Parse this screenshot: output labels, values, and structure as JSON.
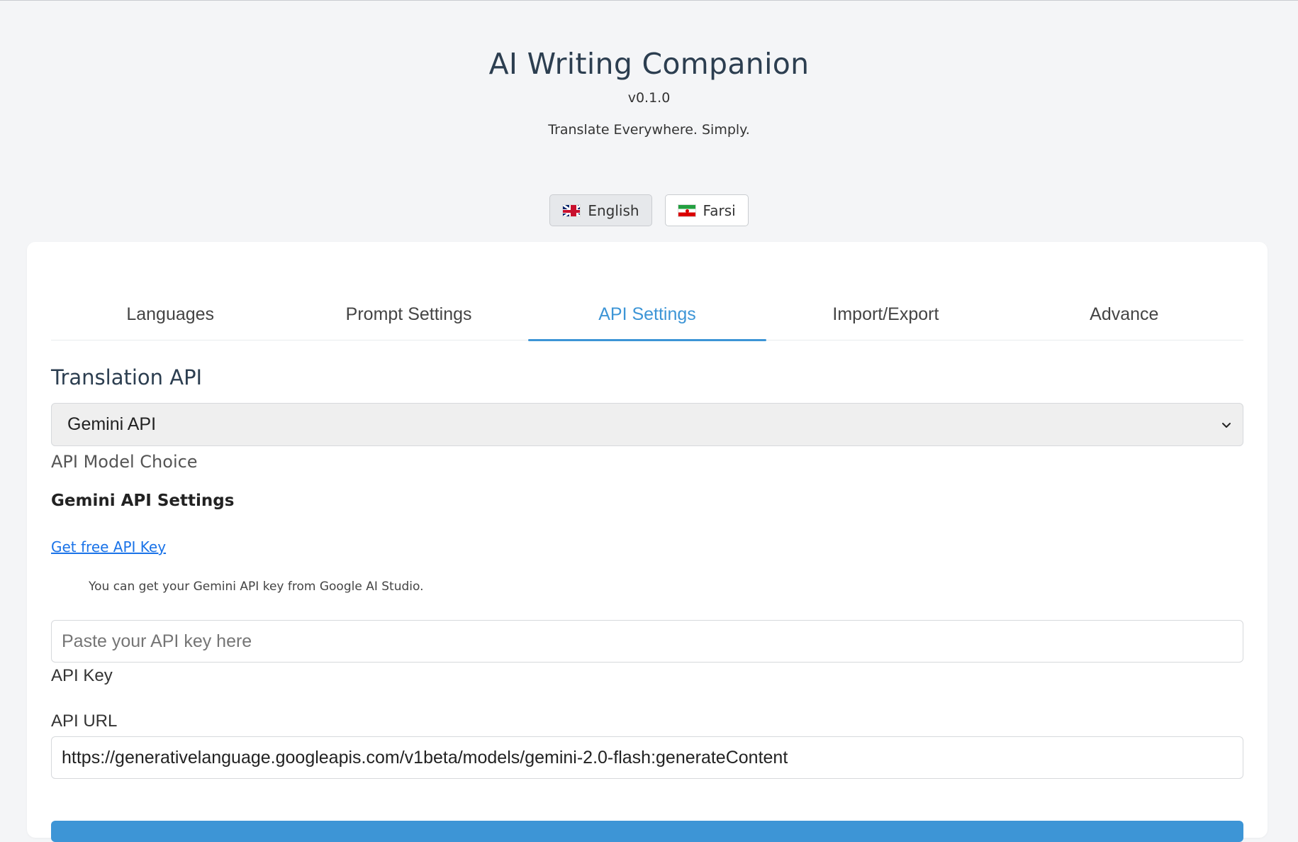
{
  "header": {
    "title": "AI Writing Companion",
    "version": "v0.1.0",
    "tagline": "Translate Everywhere. Simply."
  },
  "language_switch": {
    "options": [
      {
        "label": "English",
        "flag": "uk-flag-icon",
        "active": true
      },
      {
        "label": "Farsi",
        "flag": "iran-flag-icon",
        "active": false
      }
    ]
  },
  "tabs": [
    {
      "label": "Languages",
      "active": false
    },
    {
      "label": "Prompt Settings",
      "active": false
    },
    {
      "label": "API Settings",
      "active": true
    },
    {
      "label": "Import/Export",
      "active": false
    },
    {
      "label": "Advance",
      "active": false
    }
  ],
  "api_settings": {
    "section_title": "Translation API",
    "model_select": {
      "value": "Gemini API",
      "label": "API Model Choice"
    },
    "gemini": {
      "title": "Gemini API Settings",
      "link_text": "Get free API Key",
      "hint": "You can get your Gemini API key from Google AI Studio.",
      "api_key": {
        "placeholder": "Paste your API key here",
        "value": "",
        "label": "API Key"
      },
      "api_url": {
        "label": "API URL",
        "value": "https://generativelanguage.googleapis.com/v1beta/models/gemini-2.0-flash:generateContent"
      }
    }
  },
  "colors": {
    "accent": "#3d95d6",
    "page_background": "#f4f5f7",
    "link": "#1a73e8"
  }
}
